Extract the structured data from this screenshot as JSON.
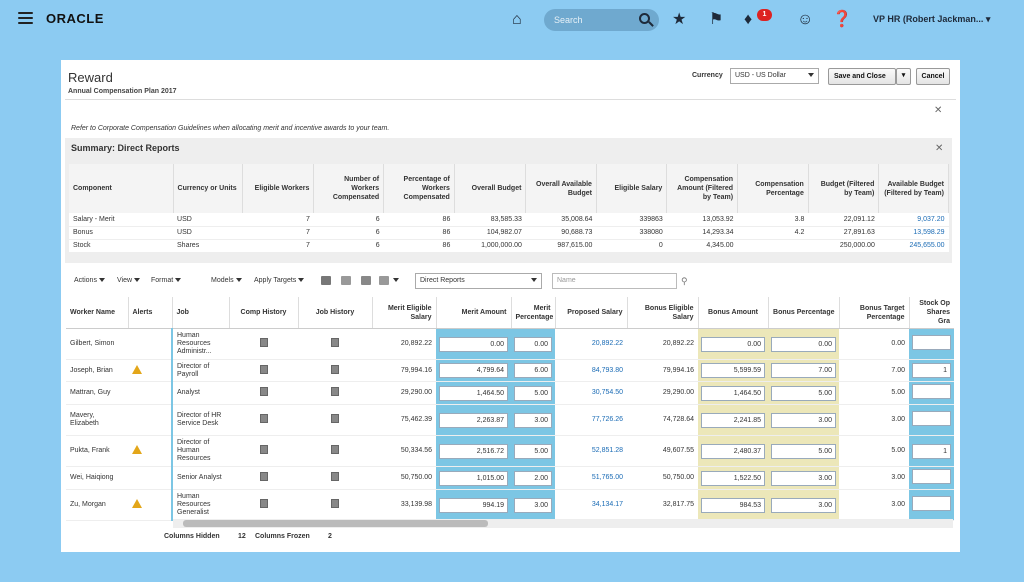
{
  "topbar": {
    "logo": "ORACLE",
    "search_placeholder": "Search",
    "notification_count": "1",
    "user": "VP HR (Robert Jackman..."
  },
  "page": {
    "title": "Reward",
    "subtitle": "Annual Compensation Plan 2017",
    "currency_label": "Currency",
    "currency_value": "USD - US Dollar",
    "save_close": "Save and Close",
    "cancel": "Cancel",
    "note": "Refer to Corporate Compensation Guidelines when allocating merit and incentive awards to your team."
  },
  "summary": {
    "title": "Summary: Direct Reports",
    "headers": [
      "Component",
      "Currency or Units",
      "Eligible Workers",
      "Number of Workers Compensated",
      "Percentage of Workers Compensated",
      "Overall Budget",
      "Overall Available Budget",
      "Eligible Salary",
      "Compensation Amount (Filtered by Team)",
      "Compensation Percentage",
      "Budget (Filtered by Team)",
      "Available Budget (Filtered by Team)"
    ],
    "rows": [
      [
        "Salary - Merit",
        "USD",
        "7",
        "6",
        "86",
        "83,585.33",
        "35,008.64",
        "339863",
        "13,053.92",
        "3.8",
        "22,091.12",
        "9,037.20"
      ],
      [
        "Bonus",
        "USD",
        "7",
        "6",
        "86",
        "104,982.07",
        "90,688.73",
        "338080",
        "14,293.34",
        "4.2",
        "27,891.63",
        "13,598.29"
      ],
      [
        "Stock",
        "Shares",
        "7",
        "6",
        "86",
        "1,000,000.00",
        "987,615.00",
        "0",
        "4,345.00",
        "",
        "250,000.00",
        "245,655.00"
      ]
    ]
  },
  "toolbar": {
    "actions": "Actions",
    "view": "View",
    "format": "Format",
    "models": "Models",
    "apply_targets": "Apply Targets",
    "filter": "Direct Reports",
    "name_placeholder": "Name"
  },
  "grid": {
    "headers": [
      "Worker Name",
      "Alerts",
      "Job",
      "Comp History",
      "Job History",
      "Merit Eligible Salary",
      "Merit Amount",
      "Merit Percentage",
      "Proposed Salary",
      "Bonus Eligible Salary",
      "Bonus Amount",
      "Bonus Percentage",
      "Bonus Target Percentage",
      "Stock Op Shares Gra"
    ],
    "rows": [
      {
        "name": "Gilbert, Simon",
        "alert": false,
        "job": "Human Resources Administr...",
        "merit_eligible": "20,892.22",
        "merit_amount": "0.00",
        "merit_pct": "0.00",
        "proposed": "20,892.22",
        "bonus_eligible": "20,892.22",
        "bonus_amount": "0.00",
        "bonus_pct": "0.00",
        "bonus_target": "0.00",
        "stock": ""
      },
      {
        "name": "Joseph, Brian",
        "alert": true,
        "job": "Director of Payroll",
        "merit_eligible": "79,994.16",
        "merit_amount": "4,799.64",
        "merit_pct": "6.00",
        "proposed": "84,793.80",
        "bonus_eligible": "79,994.16",
        "bonus_amount": "5,599.59",
        "bonus_pct": "7.00",
        "bonus_target": "7.00",
        "stock": "1"
      },
      {
        "name": "Mattran, Guy",
        "alert": false,
        "job": "Analyst",
        "merit_eligible": "29,290.00",
        "merit_amount": "1,464.50",
        "merit_pct": "5.00",
        "proposed": "30,754.50",
        "bonus_eligible": "29,290.00",
        "bonus_amount": "1,464.50",
        "bonus_pct": "5.00",
        "bonus_target": "5.00",
        "stock": ""
      },
      {
        "name": "Mavery, Elizabeth",
        "alert": false,
        "job": "Director of HR Service Desk",
        "merit_eligible": "75,462.39",
        "merit_amount": "2,263.87",
        "merit_pct": "3.00",
        "proposed": "77,726.26",
        "bonus_eligible": "74,728.64",
        "bonus_amount": "2,241.85",
        "bonus_pct": "3.00",
        "bonus_target": "3.00",
        "stock": ""
      },
      {
        "name": "Pukta, Frank",
        "alert": true,
        "job": "Director of Human Resources",
        "merit_eligible": "50,334.56",
        "merit_amount": "2,516.72",
        "merit_pct": "5.00",
        "proposed": "52,851.28",
        "bonus_eligible": "49,607.55",
        "bonus_amount": "2,480.37",
        "bonus_pct": "5.00",
        "bonus_target": "5.00",
        "stock": "1"
      },
      {
        "name": "Wei, Haiqiong",
        "alert": false,
        "job": "Senior Analyst",
        "merit_eligible": "50,750.00",
        "merit_amount": "1,015.00",
        "merit_pct": "2.00",
        "proposed": "51,765.00",
        "bonus_eligible": "50,750.00",
        "bonus_amount": "1,522.50",
        "bonus_pct": "3.00",
        "bonus_target": "3.00",
        "stock": ""
      },
      {
        "name": "Zu, Morgan",
        "alert": true,
        "job": "Human Resources Generalist",
        "merit_eligible": "33,139.98",
        "merit_amount": "994.19",
        "merit_pct": "3.00",
        "proposed": "34,134.17",
        "bonus_eligible": "32,817.75",
        "bonus_amount": "984.53",
        "bonus_pct": "3.00",
        "bonus_target": "3.00",
        "stock": ""
      }
    ]
  },
  "footer": {
    "columns_hidden_label": "Columns Hidden",
    "columns_hidden": "12",
    "columns_frozen_label": "Columns Frozen",
    "columns_frozen": "2"
  }
}
